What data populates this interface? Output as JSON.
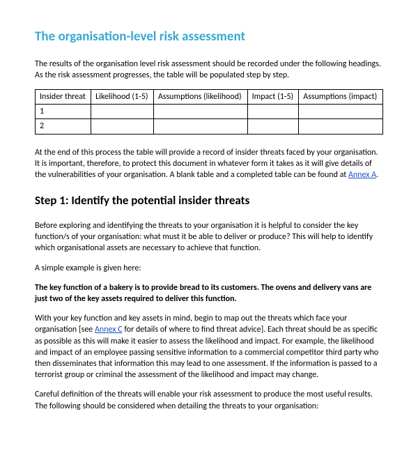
{
  "title": "The organisation-level risk assessment",
  "intro": "The results of the organisation level risk assessment should be recorded under the following headings. As the risk assessment progresses, the table will be populated step by step.",
  "table": {
    "headers": [
      "Insider threat",
      "Likelihood (1-5)",
      "Assumptions (likelihood)",
      "Impact (1-5)",
      "Assumptions (impact)"
    ],
    "rows": [
      {
        "num": "1"
      },
      {
        "num": "2"
      }
    ]
  },
  "after_table_pre": "At the end of this process the table will provide a record of insider threats faced by your organisation. It is important, therefore, to protect this document in whatever form it takes as it will give details of the vulnerabilities of your organisation. A blank table and a completed table can be found at ",
  "annex_a": "Annex A",
  "after_table_post": ".",
  "step1_title": "Step 1: Identify the potential insider threats",
  "step1_p1": "Before exploring and identifying the threats to your organisation it is helpful to consider the key function/s of your organisation: what must it be able to deliver or produce? This will help to identify which organisational assets are necessary to achieve that function.",
  "step1_p2": "A simple example is given here:",
  "step1_example": "The key function of a bakery is to provide bread to its customers. The ovens and delivery vans are just two of the key assets required to deliver this function.",
  "step1_p3_pre": "With your key function and key assets in mind, begin to map out the threats which face your organisation [see ",
  "annex_c": "Annex C",
  "step1_p3_post": " for details of where to find threat advice]. Each threat should be as specific as possible as this will make it easier to assess the likelihood and impact. For example, the likelihood and impact of an employee passing sensitive information to a commercial competitor third party who then disseminates that information this may lead to one assessment. If the information is passed to a terrorist group or criminal the assessment of the likelihood and impact may change.",
  "step1_p4": "Careful definition of the threats will enable your risk assessment to produce the most useful results. The following should be considered when detailing the threats to your organisation:"
}
